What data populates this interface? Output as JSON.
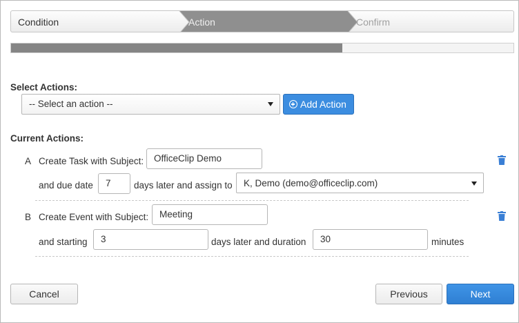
{
  "wizard": {
    "steps": [
      {
        "label": "Condition",
        "state": "done"
      },
      {
        "label": "Action",
        "state": "active"
      },
      {
        "label": "Confirm",
        "state": "pending"
      }
    ],
    "progress": 0.66
  },
  "select_actions": {
    "label": "Select Actions:",
    "dropdown_value": "-- Select an action --",
    "add_button_label": "Add Action"
  },
  "current_actions": {
    "label": "Current Actions:",
    "items": [
      {
        "letter": "A",
        "subject_prefix": "Create Task with Subject:",
        "subject_value": "OfficeClip Demo",
        "due_prefix": "and due date",
        "days_value": "7",
        "assign_text": "days later and assign to",
        "assignee": "K, Demo (demo@officeclip.com)"
      },
      {
        "letter": "B",
        "subject_prefix": "Create Event with Subject:",
        "subject_value": "Meeting",
        "start_prefix": "and starting",
        "start_value": "3",
        "duration_text": "days later and duration",
        "duration_value": "30",
        "minutes_text": "minutes"
      }
    ]
  },
  "footer": {
    "cancel_label": "Cancel",
    "previous_label": "Previous",
    "next_label": "Next"
  },
  "colors": {
    "primary": "#3c8de0",
    "active_step": "#8c8c8c",
    "trash_icon": "#3a7fd5"
  }
}
